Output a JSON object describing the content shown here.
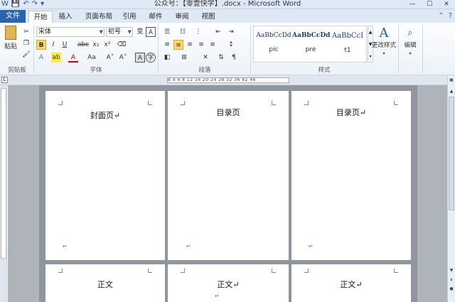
{
  "window": {
    "title": "公众号：【零壹快学】.docx - Microsoft Word",
    "qat": [
      "W",
      "💾",
      "↶",
      "↷",
      "▾"
    ],
    "controls": [
      "—",
      "☐",
      "✕"
    ]
  },
  "tabs": {
    "file": "文件",
    "items": [
      "开始",
      "插入",
      "页面布局",
      "引用",
      "邮件",
      "审阅",
      "视图"
    ],
    "active": "开始"
  },
  "ribbon": {
    "clipboard": {
      "label": "剪贴板",
      "paste": "粘贴"
    },
    "font": {
      "label": "字体",
      "name": "宋体",
      "size": "初号",
      "bold": "B",
      "italic": "I",
      "underline": "U",
      "strike": "abc",
      "sub": "x₂",
      "sup": "x²",
      "font_color": "A",
      "case": "Aa",
      "grow": "A˄",
      "shrink": "A˅"
    },
    "paragraph": {
      "label": "段落"
    },
    "styles": {
      "label": "样式",
      "items": [
        {
          "sample": "AaBbCcDd",
          "name": "pic"
        },
        {
          "sample": "AaBbCcDd",
          "name": "pre"
        },
        {
          "sample": "AaBbCcI",
          "name": "t1"
        }
      ],
      "change": "更改样式"
    },
    "editing": {
      "label": "编辑"
    }
  },
  "ruler": {
    "scale": "8 4  4 8 12 16 20 24 28 32 36  42 46"
  },
  "pages": [
    {
      "title": "封面页↵"
    },
    {
      "title": "目录页"
    },
    {
      "title": "目录页↵"
    },
    {
      "title": "正文"
    },
    {
      "title": "正文↵"
    },
    {
      "title": "正文↵"
    }
  ],
  "paragraph_mark": "↵"
}
